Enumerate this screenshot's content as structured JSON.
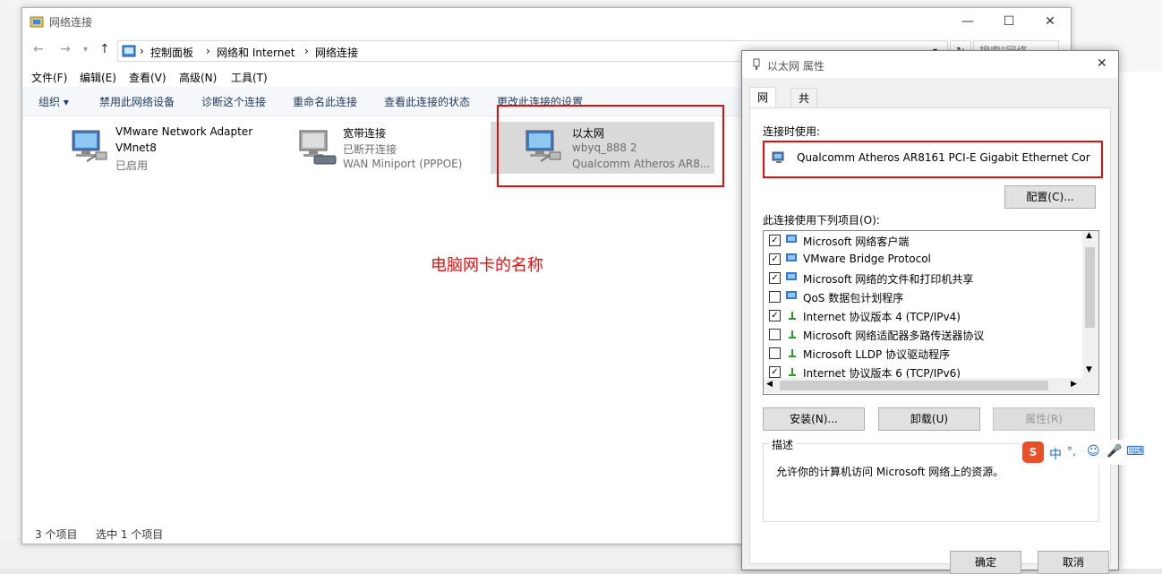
{
  "explorer": {
    "title": "网络连接",
    "breadcrumb": [
      "控制面板",
      "网络和 Internet",
      "网络连接"
    ],
    "menu": [
      "文件(F)",
      "编辑(E)",
      "查看(V)",
      "高级(N)",
      "工具(T)"
    ],
    "commands": [
      "组织 ▾",
      "禁用此网络设备",
      "诊断这个连接",
      "重命名此连接",
      "查看此连接的状态",
      "更改此连接的设置"
    ],
    "items": [
      {
        "name": "VMware Network Adapter",
        "line2": "VMnet8",
        "line3": "已启用"
      },
      {
        "name": "宽带连接",
        "line2": "已断开连接",
        "line3": "WAN Miniport (PPPOE)"
      },
      {
        "name": "以太网",
        "line2": "wbyq_888 2",
        "line3": "Qualcomm Atheros AR8..."
      }
    ],
    "annotation": "电脑网卡的名称",
    "status_count": "3 个项目",
    "status_selected": "选中 1 个项目",
    "search_placeholder": "搜索\"网络..."
  },
  "dialog": {
    "title": "以太网 属性",
    "tabs": [
      "网络",
      "共享"
    ],
    "connect_using_label": "连接时使用:",
    "adapter": "Qualcomm Atheros AR8161 PCI-E Gigabit Ethernet Cor",
    "configure_button": "配置(C)...",
    "items_label": "此连接使用下列项目(O):",
    "items": [
      {
        "checked": true,
        "label": "Microsoft 网络客户端"
      },
      {
        "checked": true,
        "label": "VMware Bridge Protocol"
      },
      {
        "checked": true,
        "label": "Microsoft 网络的文件和打印机共享"
      },
      {
        "checked": false,
        "label": "QoS 数据包计划程序"
      },
      {
        "checked": true,
        "label": "Internet 协议版本 4 (TCP/IPv4)"
      },
      {
        "checked": false,
        "label": "Microsoft 网络适配器多路传送器协议"
      },
      {
        "checked": false,
        "label": "Microsoft LLDP 协议驱动程序"
      },
      {
        "checked": true,
        "label": "Internet 协议版本 6 (TCP/IPv6)"
      }
    ],
    "install_button": "安装(N)...",
    "uninstall_button": "卸载(U)",
    "properties_button": "属性(R)",
    "description_label": "描述",
    "description_text": "允许你的计算机访问 Microsoft 网络上的资源。",
    "ok_button": "确定",
    "cancel_button": "取消"
  },
  "ime": {
    "lang": "中"
  },
  "colors": {
    "red": "#e01010",
    "selected": "#d9d9d9",
    "command_text": "#1e395b"
  }
}
